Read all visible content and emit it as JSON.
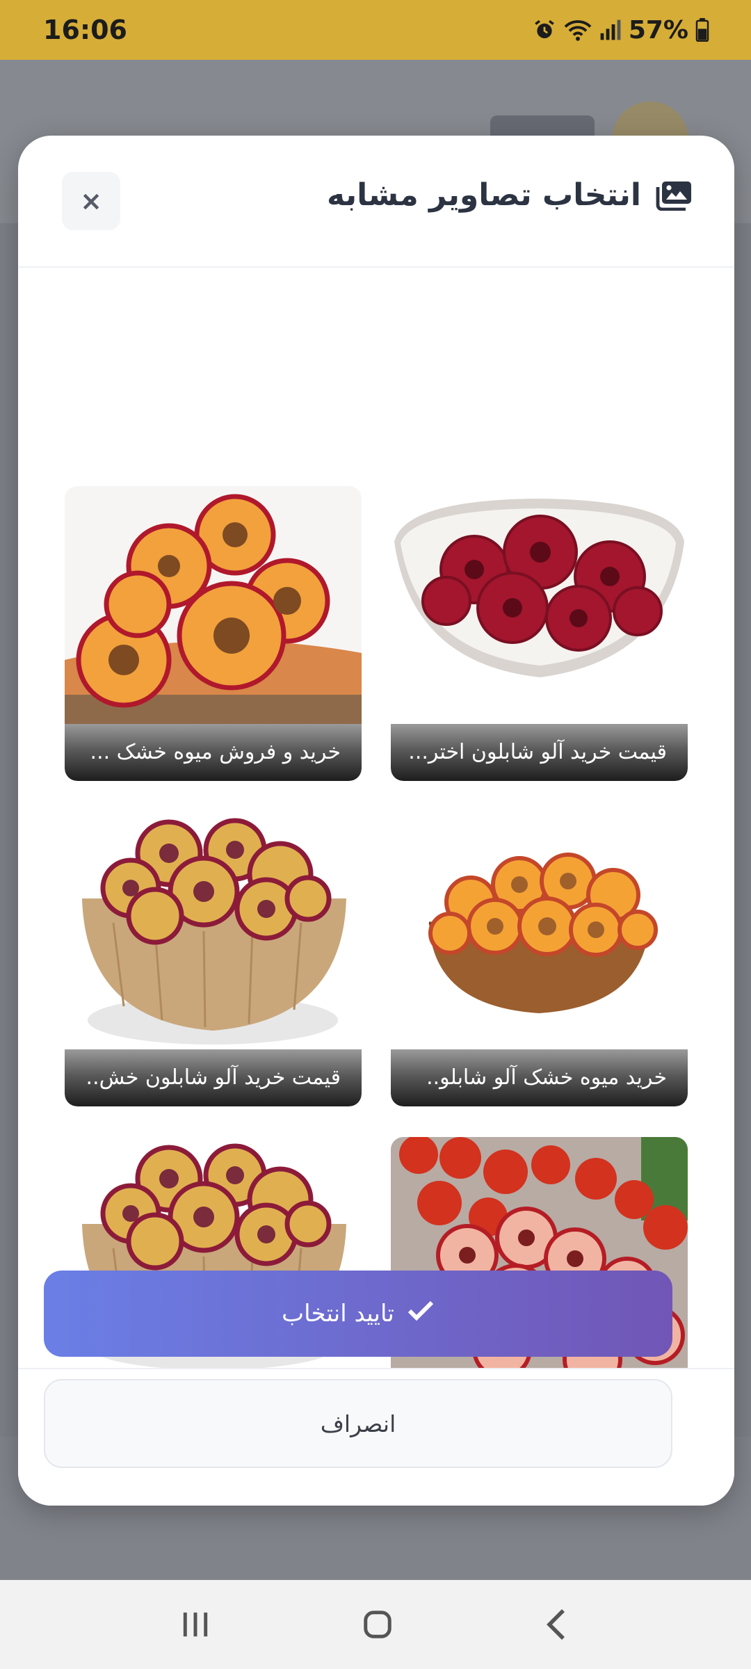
{
  "status_bar": {
    "time": "16:06",
    "battery": "57%",
    "icons": [
      "alarm-icon",
      "wifi-icon",
      "signal-icon",
      "battery-icon"
    ]
  },
  "modal": {
    "title": "انتخاب تصاویر مشابه",
    "title_icon": "images-icon",
    "close_label": "×",
    "cards": [
      {
        "caption": "قیمت خرید آلو شابلون اختر...",
        "image": "red-dried-plum-rings-in-white-bowl"
      },
      {
        "caption": "خرید و فروش میوه خشک ...",
        "image": "orange-dried-plum-rings-on-wood-slice"
      },
      {
        "caption": "خرید میوه خشک آلو شابلو..",
        "image": "orange-dried-plum-in-wooden-bowl"
      },
      {
        "caption": "قیمت خرید آلو شابلون خش..",
        "image": "mixed-dried-plum-in-wooden-bowl"
      },
      {
        "caption": "",
        "image": "fresh-and-dried-plums-on-table"
      },
      {
        "caption": "",
        "image": "mixed-dried-plum-in-wooden-bowl"
      }
    ],
    "confirm_label": "تایید انتخاب",
    "cancel_label": "انصراف"
  },
  "colors": {
    "status_bar": "#d6ad37",
    "confirm_gradient_start": "#6a7fe6",
    "confirm_gradient_end": "#7156b6"
  },
  "nav_bar": {
    "icons": [
      "recent-apps-icon",
      "home-icon",
      "back-icon"
    ]
  }
}
